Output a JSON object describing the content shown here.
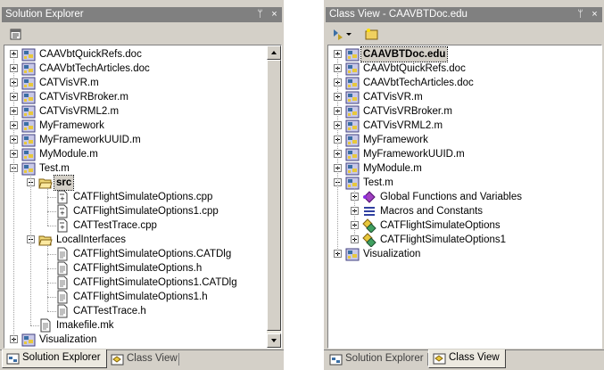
{
  "solution_explorer": {
    "title": "Solution Explorer",
    "pin": "ᛘ",
    "close": "×",
    "items": [
      {
        "label": "CAAVbtQuickRefs.doc",
        "icon": "project-icon",
        "expander": "plus"
      },
      {
        "label": "CAAVbtTechArticles.doc",
        "icon": "project-icon",
        "expander": "plus"
      },
      {
        "label": "CATVisVR.m",
        "icon": "project-icon",
        "expander": "plus"
      },
      {
        "label": "CATVisVRBroker.m",
        "icon": "project-icon",
        "expander": "plus"
      },
      {
        "label": "CATVisVRML2.m",
        "icon": "project-icon",
        "expander": "plus"
      },
      {
        "label": "MyFramework",
        "icon": "project-icon",
        "expander": "plus"
      },
      {
        "label": "MyFrameworkUUID.m",
        "icon": "project-icon",
        "expander": "plus"
      },
      {
        "label": "MyModule.m",
        "icon": "project-icon",
        "expander": "plus"
      },
      {
        "label": "Test.m",
        "icon": "project-icon",
        "expander": "minus"
      },
      {
        "label": "src",
        "icon": "folder-open-icon",
        "expander": "minus",
        "selected": true
      },
      {
        "label": "CATFlightSimulateOptions.cpp",
        "icon": "cpp-file-icon"
      },
      {
        "label": "CATFlightSimulateOptions1.cpp",
        "icon": "cpp-file-icon"
      },
      {
        "label": "CATTestTrace.cpp",
        "icon": "cpp-file-icon"
      },
      {
        "label": "LocalInterfaces",
        "icon": "folder-open-icon",
        "expander": "minus"
      },
      {
        "label": "CATFlightSimulateOptions.CATDlg",
        "icon": "text-file-icon"
      },
      {
        "label": "CATFlightSimulateOptions.h",
        "icon": "text-file-icon"
      },
      {
        "label": "CATFlightSimulateOptions1.CATDlg",
        "icon": "text-file-icon"
      },
      {
        "label": "CATFlightSimulateOptions1.h",
        "icon": "text-file-icon"
      },
      {
        "label": "CATTestTrace.h",
        "icon": "text-file-icon"
      },
      {
        "label": "Imakefile.mk",
        "icon": "text-file-icon"
      },
      {
        "label": "Visualization",
        "icon": "project-icon",
        "expander": "plus"
      }
    ],
    "tabs": [
      {
        "label": "Solution Explorer",
        "active": true
      },
      {
        "label": "Class View",
        "active": false
      }
    ]
  },
  "class_view": {
    "title": "Class View - CAAVBTDoc.edu",
    "pin": "ᛘ",
    "close": "×",
    "items": [
      {
        "label": "CAAVBTDoc.edu",
        "icon": "project-icon",
        "expander": "plus",
        "selected": true
      },
      {
        "label": "CAAVbtQuickRefs.doc",
        "icon": "project-icon",
        "expander": "plus"
      },
      {
        "label": "CAAVbtTechArticles.doc",
        "icon": "project-icon",
        "expander": "plus"
      },
      {
        "label": "CATVisVR.m",
        "icon": "project-icon",
        "expander": "plus"
      },
      {
        "label": "CATVisVRBroker.m",
        "icon": "project-icon",
        "expander": "plus"
      },
      {
        "label": "CATVisVRML2.m",
        "icon": "project-icon",
        "expander": "plus"
      },
      {
        "label": "MyFramework",
        "icon": "project-icon",
        "expander": "plus"
      },
      {
        "label": "MyFrameworkUUID.m",
        "icon": "project-icon",
        "expander": "plus"
      },
      {
        "label": "MyModule.m",
        "icon": "project-icon",
        "expander": "plus"
      },
      {
        "label": "Test.m",
        "icon": "project-icon",
        "expander": "minus"
      },
      {
        "label": "Global Functions and Variables",
        "icon": "global-functions-icon",
        "expander": "plus"
      },
      {
        "label": "Macros and Constants",
        "icon": "macros-icon",
        "expander": "plus"
      },
      {
        "label": "CATFlightSimulateOptions",
        "icon": "class-icon",
        "expander": "plus"
      },
      {
        "label": "CATFlightSimulateOptions1",
        "icon": "class-icon",
        "expander": "plus"
      },
      {
        "label": "Visualization",
        "icon": "project-icon",
        "expander": "plus"
      }
    ],
    "tabs": [
      {
        "label": "Solution Explorer",
        "active": false
      },
      {
        "label": "Class View",
        "active": true
      }
    ]
  },
  "colors": {
    "titlebar": "#808080",
    "panel_bg": "#d4d0c8",
    "tree_bg": "#ffffff"
  }
}
